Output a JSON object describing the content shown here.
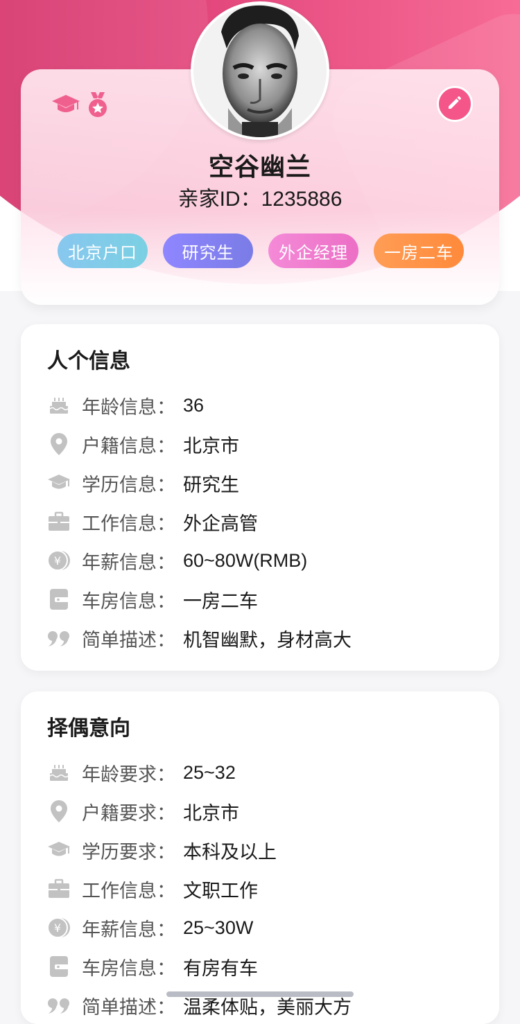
{
  "profile": {
    "name": "空谷幽兰",
    "id_label": "亲家ID：",
    "id_value": "1235886",
    "tags": [
      {
        "label": "北京户口",
        "color": "#7ccbe8"
      },
      {
        "label": "研究生",
        "color": "#7f7ff0"
      },
      {
        "label": "外企经理",
        "color": "#ef7bd0"
      },
      {
        "label": "一房二车",
        "color": "#ff9147"
      }
    ],
    "badge_icons": [
      "graduation-cap-icon",
      "medal-icon"
    ],
    "accent": "#f5568a"
  },
  "personal": {
    "title": "人个信息",
    "rows": [
      {
        "icon": "cake-icon",
        "label": "年龄信息：",
        "value": "36"
      },
      {
        "icon": "location-pin-icon",
        "label": "户籍信息：",
        "value": "北京市"
      },
      {
        "icon": "graduation-cap-icon",
        "label": "学历信息：",
        "value": "研究生"
      },
      {
        "icon": "briefcase-icon",
        "label": "工作信息：",
        "value": "外企高管"
      },
      {
        "icon": "yen-coin-icon",
        "label": "年薪信息：",
        "value": "60~80W(RMB)"
      },
      {
        "icon": "wallet-icon",
        "label": "车房信息：",
        "value": "一房二车"
      },
      {
        "icon": "quote-icon",
        "label": "简单描述：",
        "value": "机智幽默，身材高大"
      }
    ]
  },
  "partner": {
    "title": "择偶意向",
    "rows": [
      {
        "icon": "cake-icon",
        "label": "年龄要求：",
        "value": "25~32"
      },
      {
        "icon": "location-pin-icon",
        "label": "户籍要求：",
        "value": "北京市"
      },
      {
        "icon": "graduation-cap-icon",
        "label": "学历要求：",
        "value": "本科及以上"
      },
      {
        "icon": "briefcase-icon",
        "label": "工作信息：",
        "value": "文职工作"
      },
      {
        "icon": "yen-coin-icon",
        "label": "年薪信息：",
        "value": "25~30W"
      },
      {
        "icon": "wallet-icon",
        "label": "车房信息：",
        "value": "有房有车"
      },
      {
        "icon": "quote-icon",
        "label": "简单描述：",
        "value": "温柔体贴，美丽大方"
      }
    ]
  }
}
